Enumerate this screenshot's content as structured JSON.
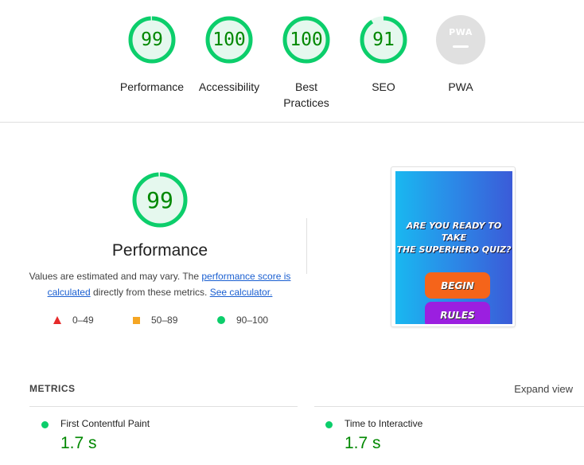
{
  "categories": [
    {
      "label": "Performance",
      "score": "99",
      "fraction": 0.99
    },
    {
      "label": "Accessibility",
      "score": "100",
      "fraction": 1.0
    },
    {
      "label": "Best Practices",
      "score": "100",
      "fraction": 1.0
    },
    {
      "label": "SEO",
      "score": "91",
      "fraction": 0.91
    },
    {
      "label": "PWA",
      "badge": "PWA"
    }
  ],
  "performance": {
    "score": "99",
    "fraction": 0.99,
    "title": "Performance",
    "desc_prefix": "Values are estimated and may vary. The ",
    "link_score": "performance score is calculated",
    "desc_mid": " directly from these metrics. ",
    "link_calc": "See calculator."
  },
  "legend": [
    {
      "shape": "triangle",
      "range": "0–49",
      "color": "#e62a2a"
    },
    {
      "shape": "square",
      "range": "50–89",
      "color": "#f5a623"
    },
    {
      "shape": "circle",
      "range": "90–100",
      "color": "#0cce6b"
    }
  ],
  "screenshot": {
    "title_line1": "ARE YOU READY TO",
    "title_line2": "TAKE",
    "title_line3": "THE SUPERHERO QUIZ?",
    "begin_label": "BEGIN",
    "rules_label": "RULES"
  },
  "metrics": {
    "heading": "METRICS",
    "expand_label": "Expand view",
    "items": [
      {
        "name": "First Contentful Paint",
        "value": "1.7 s"
      },
      {
        "name": "Time to Interactive",
        "value": "1.7 s"
      }
    ]
  },
  "colors": {
    "pass": "#0cce6b",
    "pass_text": "#008800",
    "pass_bg": "#e5f8ee"
  }
}
